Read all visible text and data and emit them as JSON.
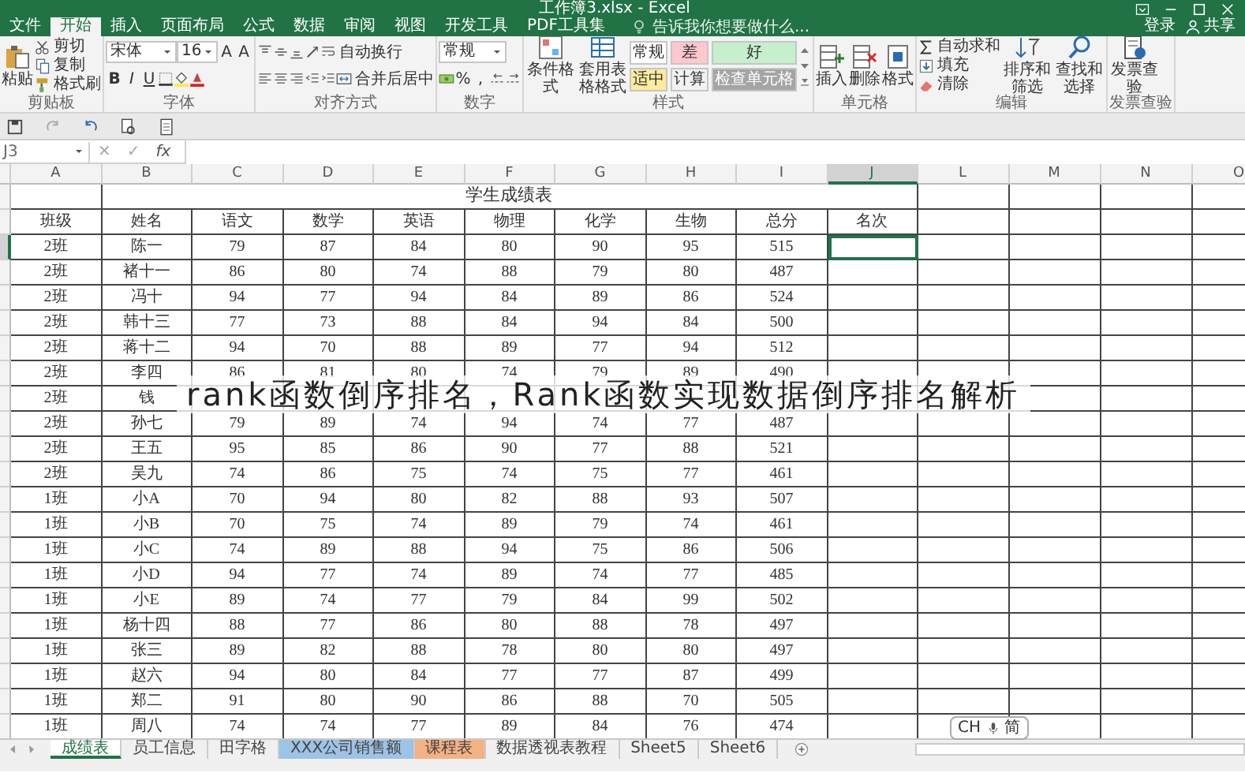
{
  "window": {
    "title": "工作簿3.xlsx - Excel",
    "sign_in": "登录",
    "share": "共享"
  },
  "menu_tabs": [
    {
      "label": "文件",
      "selected": false
    },
    {
      "label": "开始",
      "selected": true
    },
    {
      "label": "插入",
      "selected": false
    },
    {
      "label": "页面布局",
      "selected": false
    },
    {
      "label": "公式",
      "selected": false
    },
    {
      "label": "数据",
      "selected": false
    },
    {
      "label": "审阅",
      "selected": false
    },
    {
      "label": "视图",
      "selected": false
    },
    {
      "label": "开发工具",
      "selected": false
    },
    {
      "label": "PDF工具集",
      "selected": false
    }
  ],
  "tell_me": {
    "placeholder": "告诉我你想要做什么..."
  },
  "ribbon": [
    {
      "label": "剪贴板",
      "sections": [
        {
          "kind": "large",
          "label": "粘贴"
        },
        {
          "kind": "stack",
          "items": [
            {
              "label": "剪切"
            },
            {
              "label": "复制"
            },
            {
              "label": "格式刷"
            }
          ]
        }
      ]
    },
    {
      "label": "字体",
      "sections": [
        {
          "kind": "lines",
          "lines": [
            [
              {
                "kind": "select",
                "value": "宋体"
              },
              {
                "kind": "select",
                "value": "16"
              },
              {
                "kind": "glyph",
                "label": "A"
              },
              {
                "kind": "glyph",
                "label": "A"
              }
            ],
            [
              {
                "kind": "bold",
                "label": "B"
              },
              {
                "kind": "italic",
                "label": "I"
              },
              {
                "kind": "underline",
                "label": "U"
              },
              {
                "kind": "icon"
              },
              {
                "kind": "icon"
              },
              {
                "kind": "icon"
              }
            ]
          ]
        }
      ]
    },
    {
      "label": "对齐方式",
      "sections": [
        {
          "kind": "lines",
          "lines": [
            [
              {
                "kind": "icon"
              },
              {
                "kind": "icon"
              },
              {
                "kind": "icon"
              },
              {
                "kind": "icon"
              },
              {
                "kind": "small",
                "label": "自动换行"
              }
            ],
            [
              {
                "kind": "icon"
              },
              {
                "kind": "icon"
              },
              {
                "kind": "icon"
              },
              {
                "kind": "icon"
              },
              {
                "kind": "icon"
              },
              {
                "kind": "small",
                "label": "合并后居中"
              }
            ]
          ]
        }
      ]
    },
    {
      "label": "数字",
      "sections": [
        {
          "kind": "lines",
          "lines": [
            [
              {
                "kind": "select",
                "value": "常规"
              }
            ],
            [
              {
                "kind": "icon"
              },
              {
                "kind": "glyph",
                "label": "%"
              },
              {
                "kind": "glyph",
                "label": ","
              },
              {
                "kind": "icon"
              },
              {
                "kind": "icon"
              }
            ]
          ]
        }
      ]
    },
    {
      "label": "样式",
      "sections": [
        {
          "kind": "large",
          "label": "条件格式"
        },
        {
          "kind": "large",
          "label": "套用表格格式"
        },
        {
          "kind": "gallery",
          "cells": [
            {
              "label": "常规",
              "color": "#ffffff"
            },
            {
              "label": "差",
              "color": "#ffc7ce"
            },
            {
              "label": "好",
              "color": "#c6efce"
            },
            {
              "label": "适中",
              "color": "#ffeb9c"
            },
            {
              "label": "计算",
              "color": "#f2f2f2"
            },
            {
              "label": "检查单元格",
              "color": "#a5a5a5"
            }
          ]
        }
      ]
    },
    {
      "label": "单元格",
      "sections": [
        {
          "kind": "large",
          "label": "插入"
        },
        {
          "kind": "large",
          "label": "删除"
        },
        {
          "kind": "large",
          "label": "格式"
        }
      ]
    },
    {
      "label": "编辑",
      "sections": [
        {
          "kind": "stack",
          "items": [
            {
              "label": "自动求和"
            },
            {
              "label": "填充"
            },
            {
              "label": "清除"
            }
          ]
        },
        {
          "kind": "large",
          "label": "排序和筛选"
        },
        {
          "kind": "large",
          "label": "查找和选择"
        }
      ]
    },
    {
      "label": "发票查验",
      "sections": [
        {
          "kind": "large",
          "label": "发票查验"
        }
      ]
    }
  ],
  "formula_bar": {
    "name_box": "J3",
    "cancel": "✕",
    "enter": "✓",
    "function": "fx"
  },
  "sheet": {
    "columns": [
      {
        "label": "A",
        "selected": false
      },
      {
        "label": "B",
        "selected": false
      },
      {
        "label": "C",
        "selected": false
      },
      {
        "label": "D",
        "selected": false
      },
      {
        "label": "E",
        "selected": false
      },
      {
        "label": "F",
        "selected": false
      },
      {
        "label": "G",
        "selected": false
      },
      {
        "label": "H",
        "selected": false
      },
      {
        "label": "I",
        "selected": false
      },
      {
        "label": "J",
        "selected": true
      },
      {
        "label": "L",
        "selected": false
      },
      {
        "label": "M",
        "selected": false
      },
      {
        "label": "N",
        "selected": false
      },
      {
        "label": "O",
        "selected": false
      }
    ],
    "title": "学生成绩表",
    "header": [
      "班级",
      "姓名",
      "语文",
      "数学",
      "英语",
      "物理",
      "化学",
      "生物",
      "总分",
      "名次"
    ],
    "rows": [
      {
        "cells": [
          "2班",
          "陈一",
          "79",
          "87",
          "84",
          "80",
          "90",
          "95",
          "515"
        ],
        "selected": true
      },
      {
        "cells": [
          "2班",
          "褚十一",
          "86",
          "80",
          "74",
          "88",
          "79",
          "80",
          "487"
        ],
        "selected": false
      },
      {
        "cells": [
          "2班",
          "冯十",
          "94",
          "77",
          "94",
          "84",
          "89",
          "86",
          "524"
        ],
        "selected": false
      },
      {
        "cells": [
          "2班",
          "韩十三",
          "77",
          "73",
          "88",
          "84",
          "94",
          "84",
          "500"
        ],
        "selected": false
      },
      {
        "cells": [
          "2班",
          "蒋十二",
          "94",
          "70",
          "88",
          "89",
          "77",
          "94",
          "512"
        ],
        "selected": false
      },
      {
        "cells": [
          "2班",
          "李四",
          "86",
          "81",
          "80",
          "74",
          "79",
          "89",
          "490"
        ],
        "selected": false
      },
      {
        "cells": [
          "2班",
          "钱"
        ],
        "selected": false
      },
      {
        "cells": [
          "2班",
          "孙七",
          "79",
          "89",
          "74",
          "94",
          "74",
          "77",
          "487"
        ],
        "selected": false
      },
      {
        "cells": [
          "2班",
          "王五",
          "95",
          "85",
          "86",
          "90",
          "77",
          "88",
          "521"
        ],
        "selected": false
      },
      {
        "cells": [
          "2班",
          "吴九",
          "74",
          "86",
          "75",
          "74",
          "75",
          "77",
          "461"
        ],
        "selected": false
      },
      {
        "cells": [
          "1班",
          "小A",
          "70",
          "94",
          "80",
          "82",
          "88",
          "93",
          "507"
        ],
        "selected": false
      },
      {
        "cells": [
          "1班",
          "小B",
          "70",
          "75",
          "74",
          "89",
          "79",
          "74",
          "461"
        ],
        "selected": false
      },
      {
        "cells": [
          "1班",
          "小C",
          "74",
          "89",
          "88",
          "94",
          "75",
          "86",
          "506"
        ],
        "selected": false
      },
      {
        "cells": [
          "1班",
          "小D",
          "94",
          "77",
          "74",
          "89",
          "74",
          "77",
          "485"
        ],
        "selected": false
      },
      {
        "cells": [
          "1班",
          "小E",
          "89",
          "74",
          "77",
          "79",
          "84",
          "99",
          "502"
        ],
        "selected": false
      },
      {
        "cells": [
          "1班",
          "杨十四",
          "88",
          "77",
          "86",
          "80",
          "88",
          "78",
          "497"
        ],
        "selected": false
      },
      {
        "cells": [
          "1班",
          "张三",
          "89",
          "82",
          "88",
          "78",
          "80",
          "80",
          "497"
        ],
        "selected": false
      },
      {
        "cells": [
          "1班",
          "赵六",
          "94",
          "80",
          "84",
          "77",
          "77",
          "87",
          "499"
        ],
        "selected": false
      },
      {
        "cells": [
          "1班",
          "郑二",
          "91",
          "80",
          "90",
          "86",
          "88",
          "70",
          "505"
        ],
        "selected": false
      },
      {
        "cells": [
          "1班",
          "周八",
          "74",
          "74",
          "77",
          "89",
          "84",
          "76",
          "474"
        ],
        "selected": false
      }
    ]
  },
  "caption": "rank函数倒序排名，Rank函数实现数据倒序排名解析",
  "sheet_tabs": [
    {
      "label": "成绩表",
      "selected": true
    },
    {
      "label": "员工信息",
      "selected": false
    },
    {
      "label": "田字格",
      "selected": false
    },
    {
      "label": "XXX公司销售额",
      "selected": false,
      "color": "#9dc3e6"
    },
    {
      "label": "课程表",
      "selected": false,
      "color": "#f4b183"
    },
    {
      "label": "数据透视表教程",
      "selected": false
    },
    {
      "label": "Sheet5",
      "selected": false
    },
    {
      "label": "Sheet6",
      "selected": false
    }
  ],
  "ime": {
    "language": "CH",
    "mode": "简"
  }
}
